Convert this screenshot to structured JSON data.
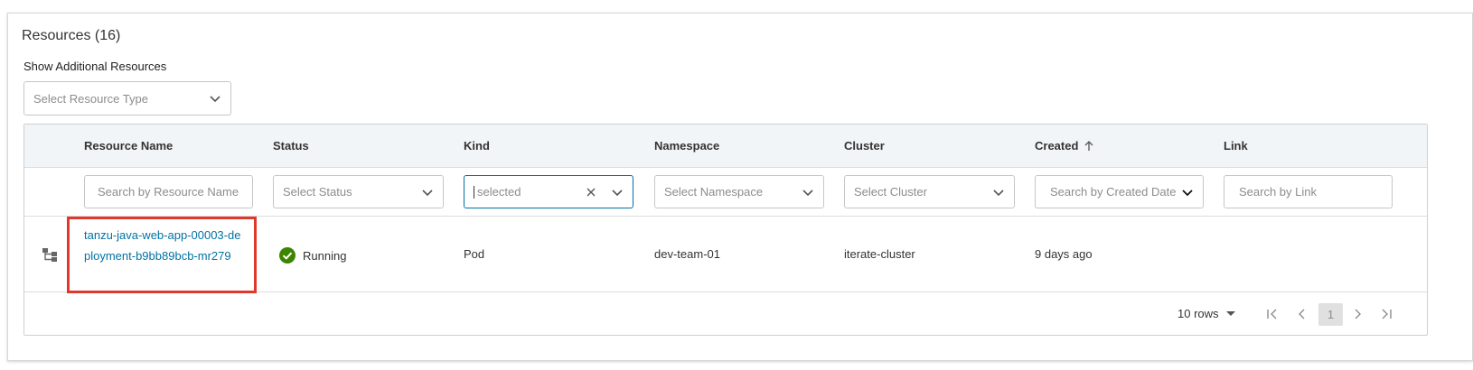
{
  "card": {
    "title": "Resources (16)",
    "additional_label": "Show Additional Resources",
    "resource_type_placeholder": "Select Resource Type"
  },
  "columns": {
    "resource_name": "Resource Name",
    "status": "Status",
    "kind": "Kind",
    "namespace": "Namespace",
    "cluster": "Cluster",
    "created": "Created",
    "link": "Link"
  },
  "filters": {
    "resource_name": "Search by Resource Name",
    "status": "Select Status",
    "kind_value": "selected",
    "namespace": "Select Namespace",
    "cluster": "Select Cluster",
    "created": "Search by Created Date",
    "link": "Search by Link"
  },
  "rows": [
    {
      "resource_name": "tanzu-java-web-app-00003-deployment-b9bb89bcb-mr279",
      "status": "Running",
      "kind": "Pod",
      "namespace": "dev-team-01",
      "cluster": "iterate-cluster",
      "created": "9 days ago",
      "link": ""
    }
  ],
  "pagination": {
    "rows_per_page": "10 rows",
    "current_page": "1"
  },
  "colors": {
    "link": "#0072a3",
    "running": "#3c8500",
    "highlight": "#e0392b",
    "header_bg": "#f2f5f7"
  },
  "icons": {
    "tree": "tree-structure-icon",
    "status": "check-circle-icon",
    "sort": "arrow-up-icon",
    "chevron": "chevron-down-icon",
    "clear": "close-icon"
  }
}
